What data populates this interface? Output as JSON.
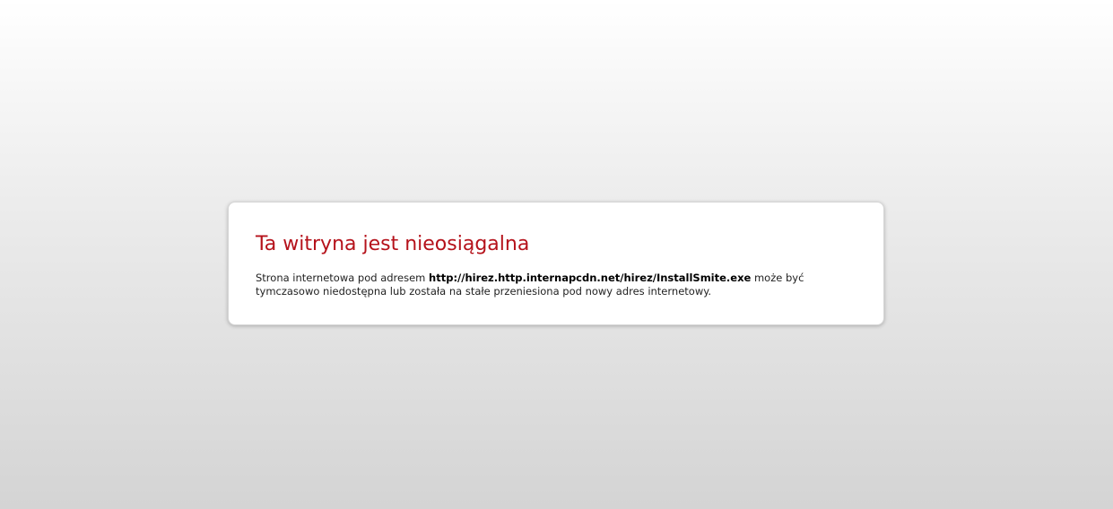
{
  "error": {
    "title": "Ta witryna jest nieosiągalna",
    "message_before": "Strona internetowa pod adresem ",
    "url": "http://hirez.http.internapcdn.net/hirez/InstallSmite.exe",
    "message_after": " może być tymczasowo niedostępna lub została na stałe przeniesiona pod nowy adres internetowy."
  },
  "colors": {
    "title": "#b5121b",
    "text": "#1f1f1f",
    "box_background": "#ffffff"
  }
}
